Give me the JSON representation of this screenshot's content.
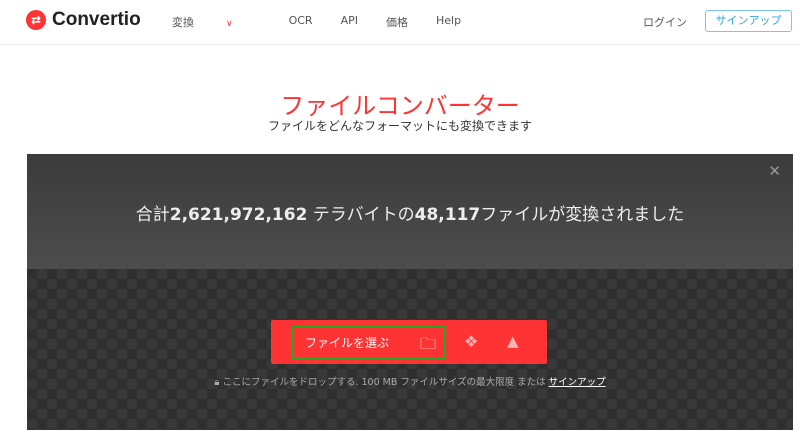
{
  "header": {
    "logo": "Convertio",
    "nav": [
      "変換",
      "OCR",
      "API",
      "価格",
      "Help"
    ],
    "login": "ログイン",
    "signup": "サインアップ"
  },
  "hero": {
    "title": "ファイルコンバーター",
    "subtitle": "ファイルをどんなフォーマットにも変換できます"
  },
  "panel": {
    "stats_prefix": "合計",
    "stats_tb": "2,621,972,162",
    "stats_mid": " テラバイトの",
    "stats_files": "48,117",
    "stats_suffix": "ファイルが変換されました",
    "choose_label": "ファイルを選ぶ",
    "drop_text": "ここにファイルをドロップする. 100 MB ファイルサイズの最大限度 または ",
    "drop_link": "サインアップ"
  },
  "colors": {
    "accent": "#ff3333",
    "signup": "#3aa6d8"
  }
}
